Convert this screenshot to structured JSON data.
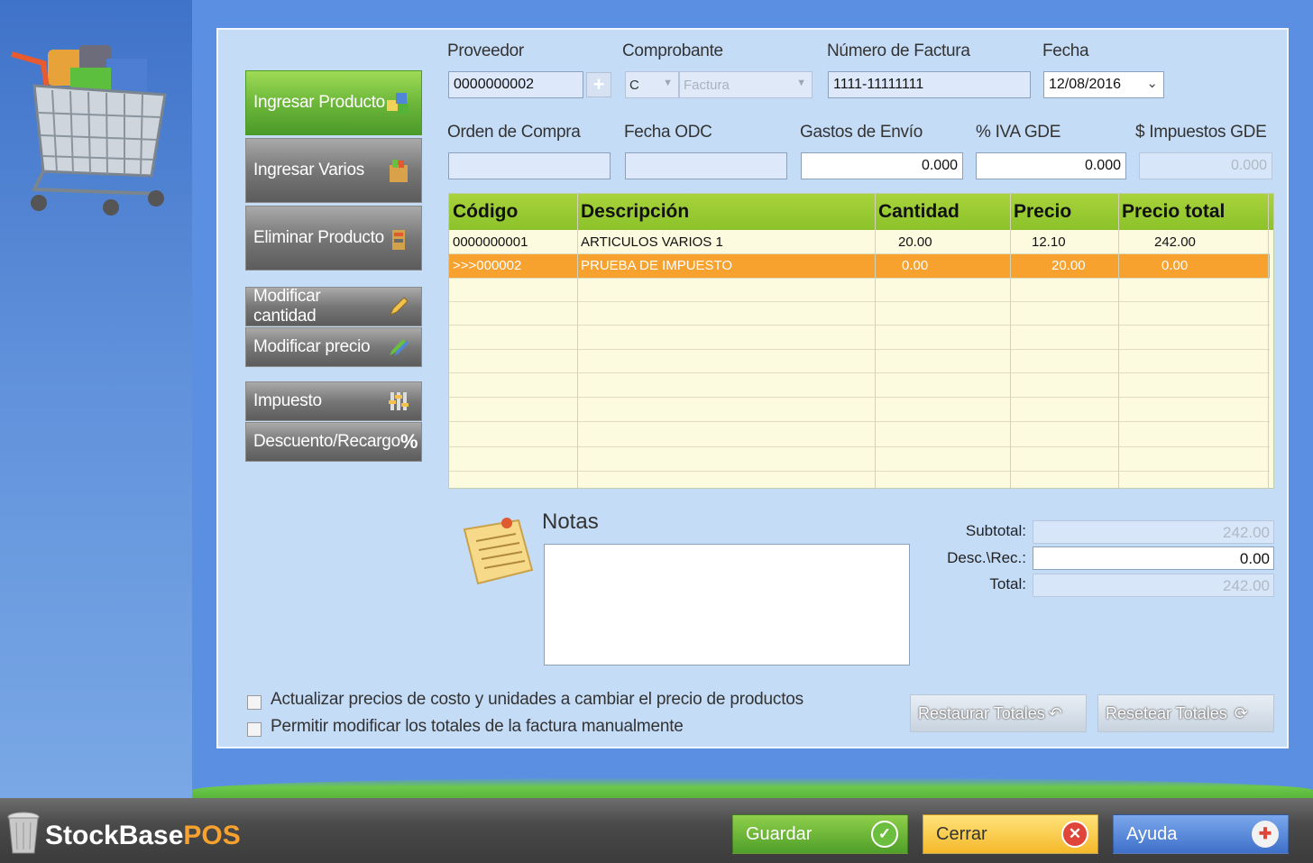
{
  "brand": {
    "name": "StockBase",
    "suffix": "POS"
  },
  "side_buttons": {
    "ingresar_producto": "Ingresar Producto",
    "ingresar_varios": "Ingresar Varios",
    "eliminar_producto": "Eliminar Producto",
    "modificar_cantidad": "Modificar cantidad",
    "modificar_precio": "Modificar precio",
    "impuesto": "Impuesto",
    "descuento_recargo": "Descuento/Recargo"
  },
  "header": {
    "proveedor_label": "Proveedor",
    "proveedor_value": "0000000002",
    "comprobante_label": "Comprobante",
    "comprobante_letter": "C",
    "comprobante_type": "Factura",
    "numero_label": "Número de Factura",
    "numero_value": "1111-11111111",
    "fecha_label": "Fecha",
    "fecha_value": "12/08/2016",
    "orden_label": "Orden de Compra",
    "orden_value": "",
    "fecha_odc_label": "Fecha ODC",
    "fecha_odc_value": "",
    "gastos_label": "Gastos de Envío",
    "gastos_value": "0.000",
    "iva_label": "% IVA GDE",
    "iva_value": "0.000",
    "impuestos_label": "$ Impuestos GDE",
    "impuestos_value": "0.000"
  },
  "table": {
    "columns": [
      "Código",
      "Descripción",
      "Cantidad",
      "Precio",
      "Precio total"
    ],
    "rows": [
      {
        "codigo": "0000000001",
        "descripcion": "ARTICULOS VARIOS 1",
        "cantidad": "20.00",
        "precio": "12.10",
        "total": "242.00",
        "selected": false
      },
      {
        "codigo": ">>>000002",
        "descripcion": "PRUEBA DE IMPUESTO",
        "cantidad": "0.00",
        "precio": "20.00",
        "total": "0.00",
        "selected": true
      }
    ]
  },
  "notes": {
    "title": "Notas",
    "value": ""
  },
  "totals": {
    "subtotal_label": "Subtotal:",
    "subtotal_value": "242.00",
    "desc_label": "Desc.\\Rec.:",
    "desc_value": "0.00",
    "total_label": "Total:",
    "total_value": "242.00"
  },
  "options": {
    "actualizar_precios": "Actualizar precios de costo y unidades a cambiar el precio de productos",
    "permitir_modificar": "Permitir modificar los totales de la factura manualmente"
  },
  "total_buttons": {
    "restaurar": "Restaurar Totales",
    "resetear": "Resetear Totales"
  },
  "footer": {
    "guardar": "Guardar",
    "cerrar": "Cerrar",
    "ayuda": "Ayuda"
  }
}
